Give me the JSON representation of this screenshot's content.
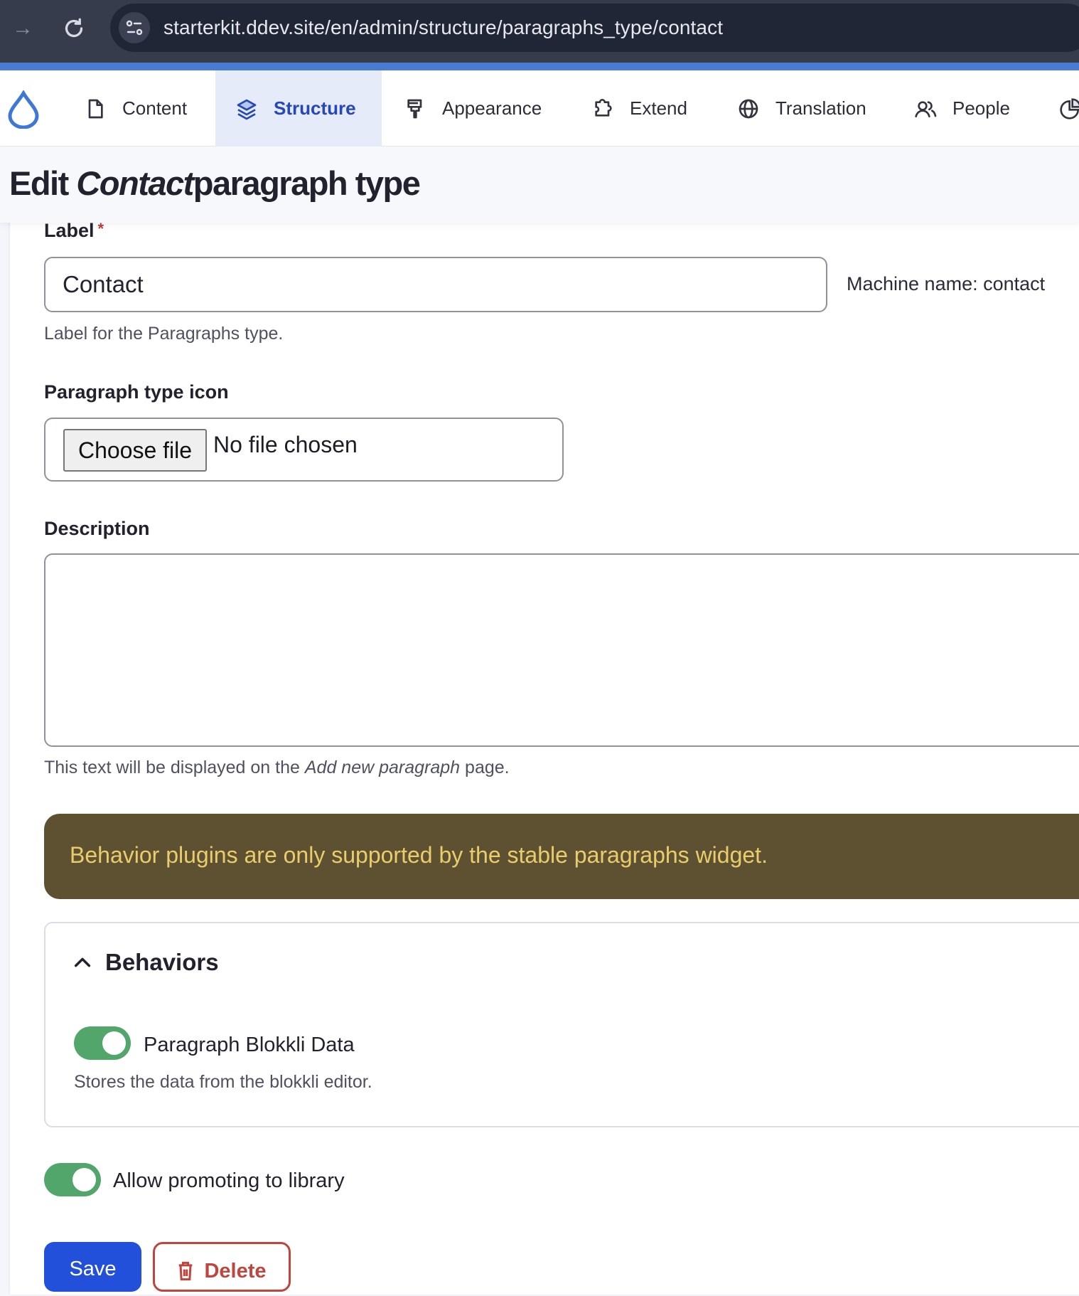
{
  "browser": {
    "url": "starterkit.ddev.site/en/admin/structure/paragraphs_type/contact",
    "icons": [
      "forward-arrow-icon",
      "reload-icon",
      "site-info-icon"
    ]
  },
  "toolbar": {
    "logo": "drupal-drop-icon",
    "tabs": [
      {
        "label": "Content",
        "icon": "document-icon",
        "active": false
      },
      {
        "label": "Structure",
        "icon": "layers-icon",
        "active": true
      },
      {
        "label": "Appearance",
        "icon": "paintbrush-icon",
        "active": false
      },
      {
        "label": "Extend",
        "icon": "puzzle-icon",
        "active": false
      },
      {
        "label": "Translation",
        "icon": "globe-icon",
        "active": false
      },
      {
        "label": "People",
        "icon": "people-icon",
        "active": false
      },
      {
        "label": "",
        "icon": "reports-pie-icon",
        "active": false
      }
    ]
  },
  "page": {
    "title_prefix": "Edit",
    "title_name": "Contact",
    "title_suffix": "paragraph type"
  },
  "form": {
    "label_field": {
      "label": "Label",
      "required_mark": "*",
      "value": "Contact",
      "machine_name": "Machine name: contact",
      "help": "Label for the Paragraphs type."
    },
    "icon_field": {
      "label": "Paragraph type icon",
      "button": "Choose file",
      "status": "No file chosen"
    },
    "description_field": {
      "label": "Description",
      "value": "",
      "help_prefix": "This text will be displayed on the",
      "help_emphasis": "Add new paragraph",
      "help_suffix": "page."
    },
    "warning": {
      "text": "Behavior plugins are only supported by the stable paragraphs widget.",
      "bg_color": "#5e5132",
      "text_color": "#e9cd6c"
    },
    "behaviors": {
      "title": "Behaviors",
      "expanded": true,
      "items": [
        {
          "label": "Paragraph Blokkli Data",
          "description": "Stores the data from the blokkli editor.",
          "enabled": true
        }
      ]
    },
    "allow_library": {
      "label": "Allow promoting to library",
      "enabled": true
    },
    "actions": {
      "save": "Save",
      "delete": "Delete"
    }
  },
  "colors": {
    "accent": "#2250da",
    "toggle_on": "#52a66c",
    "danger": "#c0453d",
    "active_tab_bg": "#e5ebf8",
    "active_tab_text": "#2547b8"
  }
}
